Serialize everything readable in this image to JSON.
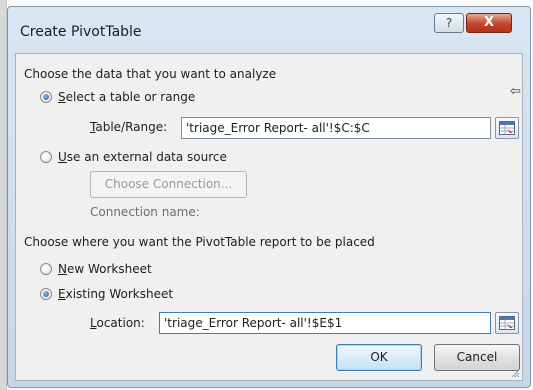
{
  "dialog": {
    "title": "Create PivotTable",
    "help_label": "?",
    "close_label": "X"
  },
  "data_section": {
    "heading": "Choose the data that you want to analyze",
    "option_table": {
      "mnemonic": "S",
      "rest": "elect a table or range",
      "selected": true
    },
    "range_label": {
      "mnemonic": "T",
      "rest": "able/Range:"
    },
    "range_value": "'triage_Error Report- all'!$C:$C",
    "option_external": {
      "mnemonic": "U",
      "rest": "se an external data source",
      "selected": false
    },
    "choose_connection_label": "Choose Connection...",
    "connection_name_label": "Connection name:"
  },
  "placement_section": {
    "heading": "Choose where you want the PivotTable report to be placed",
    "option_new": {
      "mnemonic": "N",
      "rest": "ew Worksheet",
      "selected": false
    },
    "option_existing": {
      "mnemonic": "E",
      "rest": "xisting Worksheet",
      "selected": true
    },
    "location_label": {
      "mnemonic": "L",
      "rest": "ocation:"
    },
    "location_value": "'triage_Error Report- all'!$E$1"
  },
  "buttons": {
    "ok_label": "OK",
    "cancel_label": "Cancel"
  },
  "icons": {
    "help": "help-icon",
    "close": "close-icon",
    "range_picker": "range-picker-icon",
    "cursor": "arrow-cursor-icon",
    "resize": "resize-grip-icon"
  }
}
